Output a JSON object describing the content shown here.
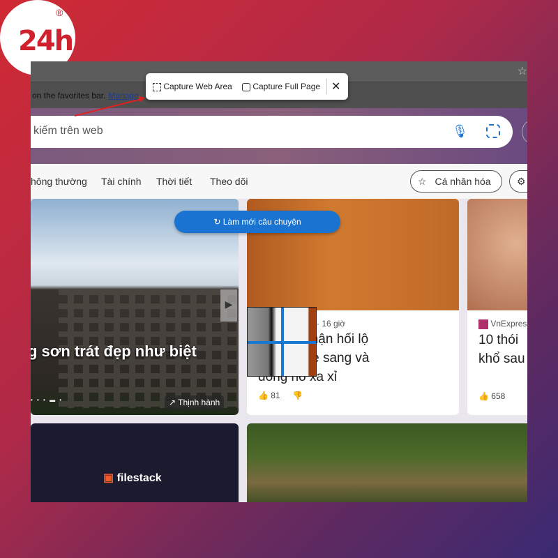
{
  "logo": {
    "text": "24h",
    "registered": "®"
  },
  "favorites_bar": {
    "text": "on the favorites bar.",
    "link": "Manage"
  },
  "capture_popup": {
    "web_area": "Capture Web Area",
    "full_page": "Capture Full Page"
  },
  "search": {
    "placeholder": "kiếm trên web"
  },
  "nav": {
    "items": [
      "hông thường",
      "Tài chính",
      "Thời tiết",
      "Theo dõi"
    ],
    "personalize": "Cá nhân hóa"
  },
  "refresh_button": "Làm mới câu chuyện",
  "cards": [
    {
      "title": "g sơn trát đẹp như biệt",
      "badge": "Thịnh hành"
    },
    {
      "meta": "· 16 giờ",
      "title": "ức Thọ nhận hối lộ\nu đô la, xe sang và\nđồng hồ xa xỉ",
      "likes": "81"
    },
    {
      "source": "VnExpres",
      "title": "10 thói\nkhổ sau",
      "likes": "658"
    },
    {
      "brand": "filestack"
    }
  ],
  "colors": {
    "accent": "#1a73d0",
    "arrow": "#e02020"
  }
}
